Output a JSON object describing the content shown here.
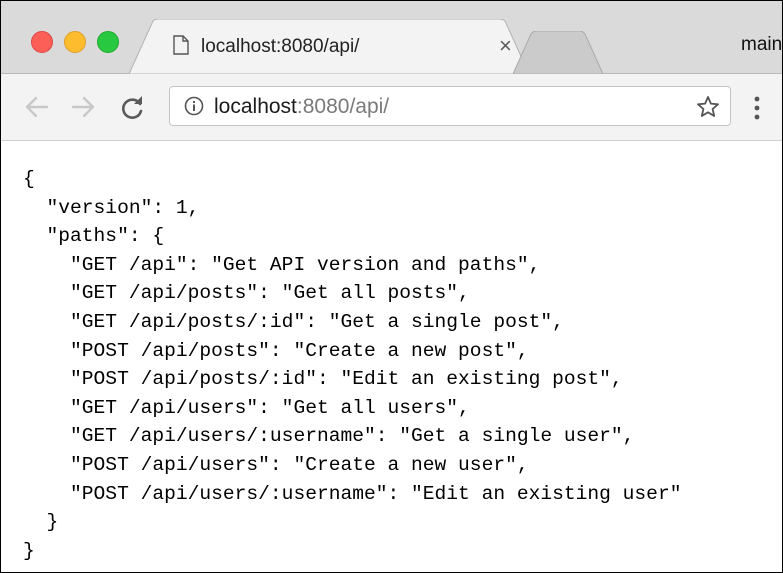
{
  "tab": {
    "title": "localhost:8080/api/",
    "close_glyph": "×"
  },
  "profile": {
    "label": "main"
  },
  "omnibox": {
    "host": "localhost",
    "rest": ":8080/api/"
  },
  "icons": {
    "back": "back-arrow-icon",
    "forward": "forward-arrow-icon",
    "reload": "reload-icon",
    "info": "info-icon",
    "star": "bookmark-star-icon",
    "menu": "kebab-menu-icon",
    "doc": "document-icon"
  },
  "colors": {
    "close": "#fc5f57",
    "minimize": "#fdbc2e",
    "maximize": "#28c840"
  },
  "json_lines": [
    "{",
    "  \"version\": 1,",
    "  \"paths\": {",
    "    \"GET /api\": \"Get API version and paths\",",
    "    \"GET /api/posts\": \"Get all posts\",",
    "    \"GET /api/posts/:id\": \"Get a single post\",",
    "    \"POST /api/posts\": \"Create a new post\",",
    "    \"POST /api/posts/:id\": \"Edit an existing post\",",
    "    \"GET /api/users\": \"Get all users\",",
    "    \"GET /api/users/:username\": \"Get a single user\",",
    "    \"POST /api/users\": \"Create a new user\",",
    "    \"POST /api/users/:username\": \"Edit an existing user\"",
    "  }",
    "}"
  ]
}
